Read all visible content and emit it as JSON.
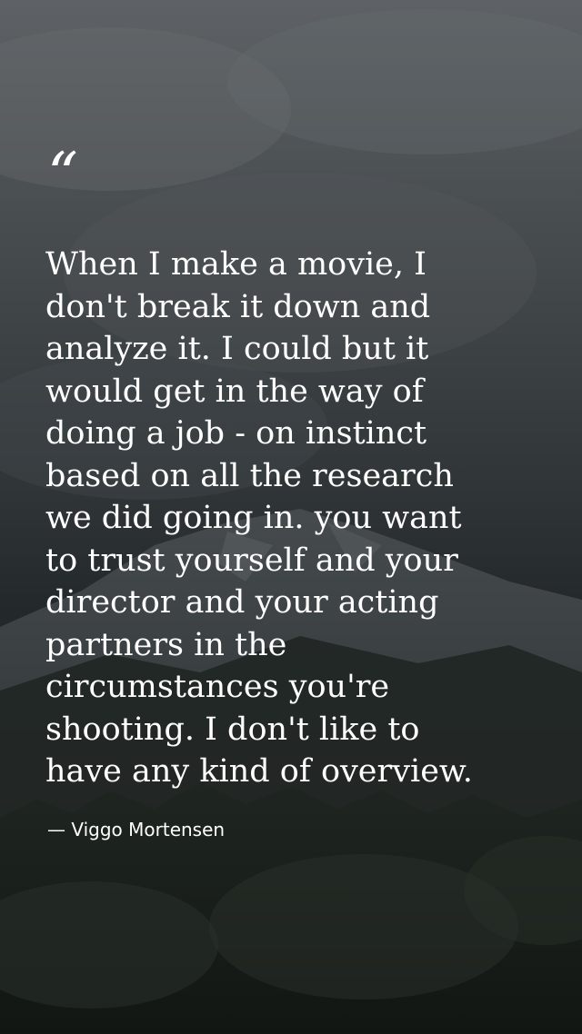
{
  "background": {
    "description_icon": "mountain-landscape-icon",
    "overlay_color": "#000000"
  },
  "quote": {
    "mark": "“",
    "lines": [
      "When I make a movie, I",
      "don't break it down and",
      "analyze it. I could but it",
      "would get in the way of",
      "doing a job - on instinct",
      "based on all the research",
      "we did going in. you want",
      "to trust yourself and your",
      "director and your acting",
      "partners in the",
      "circumstances you're",
      "shooting. I don't like to",
      "have any kind of overview."
    ],
    "attribution": "— Viggo Mortensen"
  },
  "colors": {
    "text": "#ffffff"
  }
}
